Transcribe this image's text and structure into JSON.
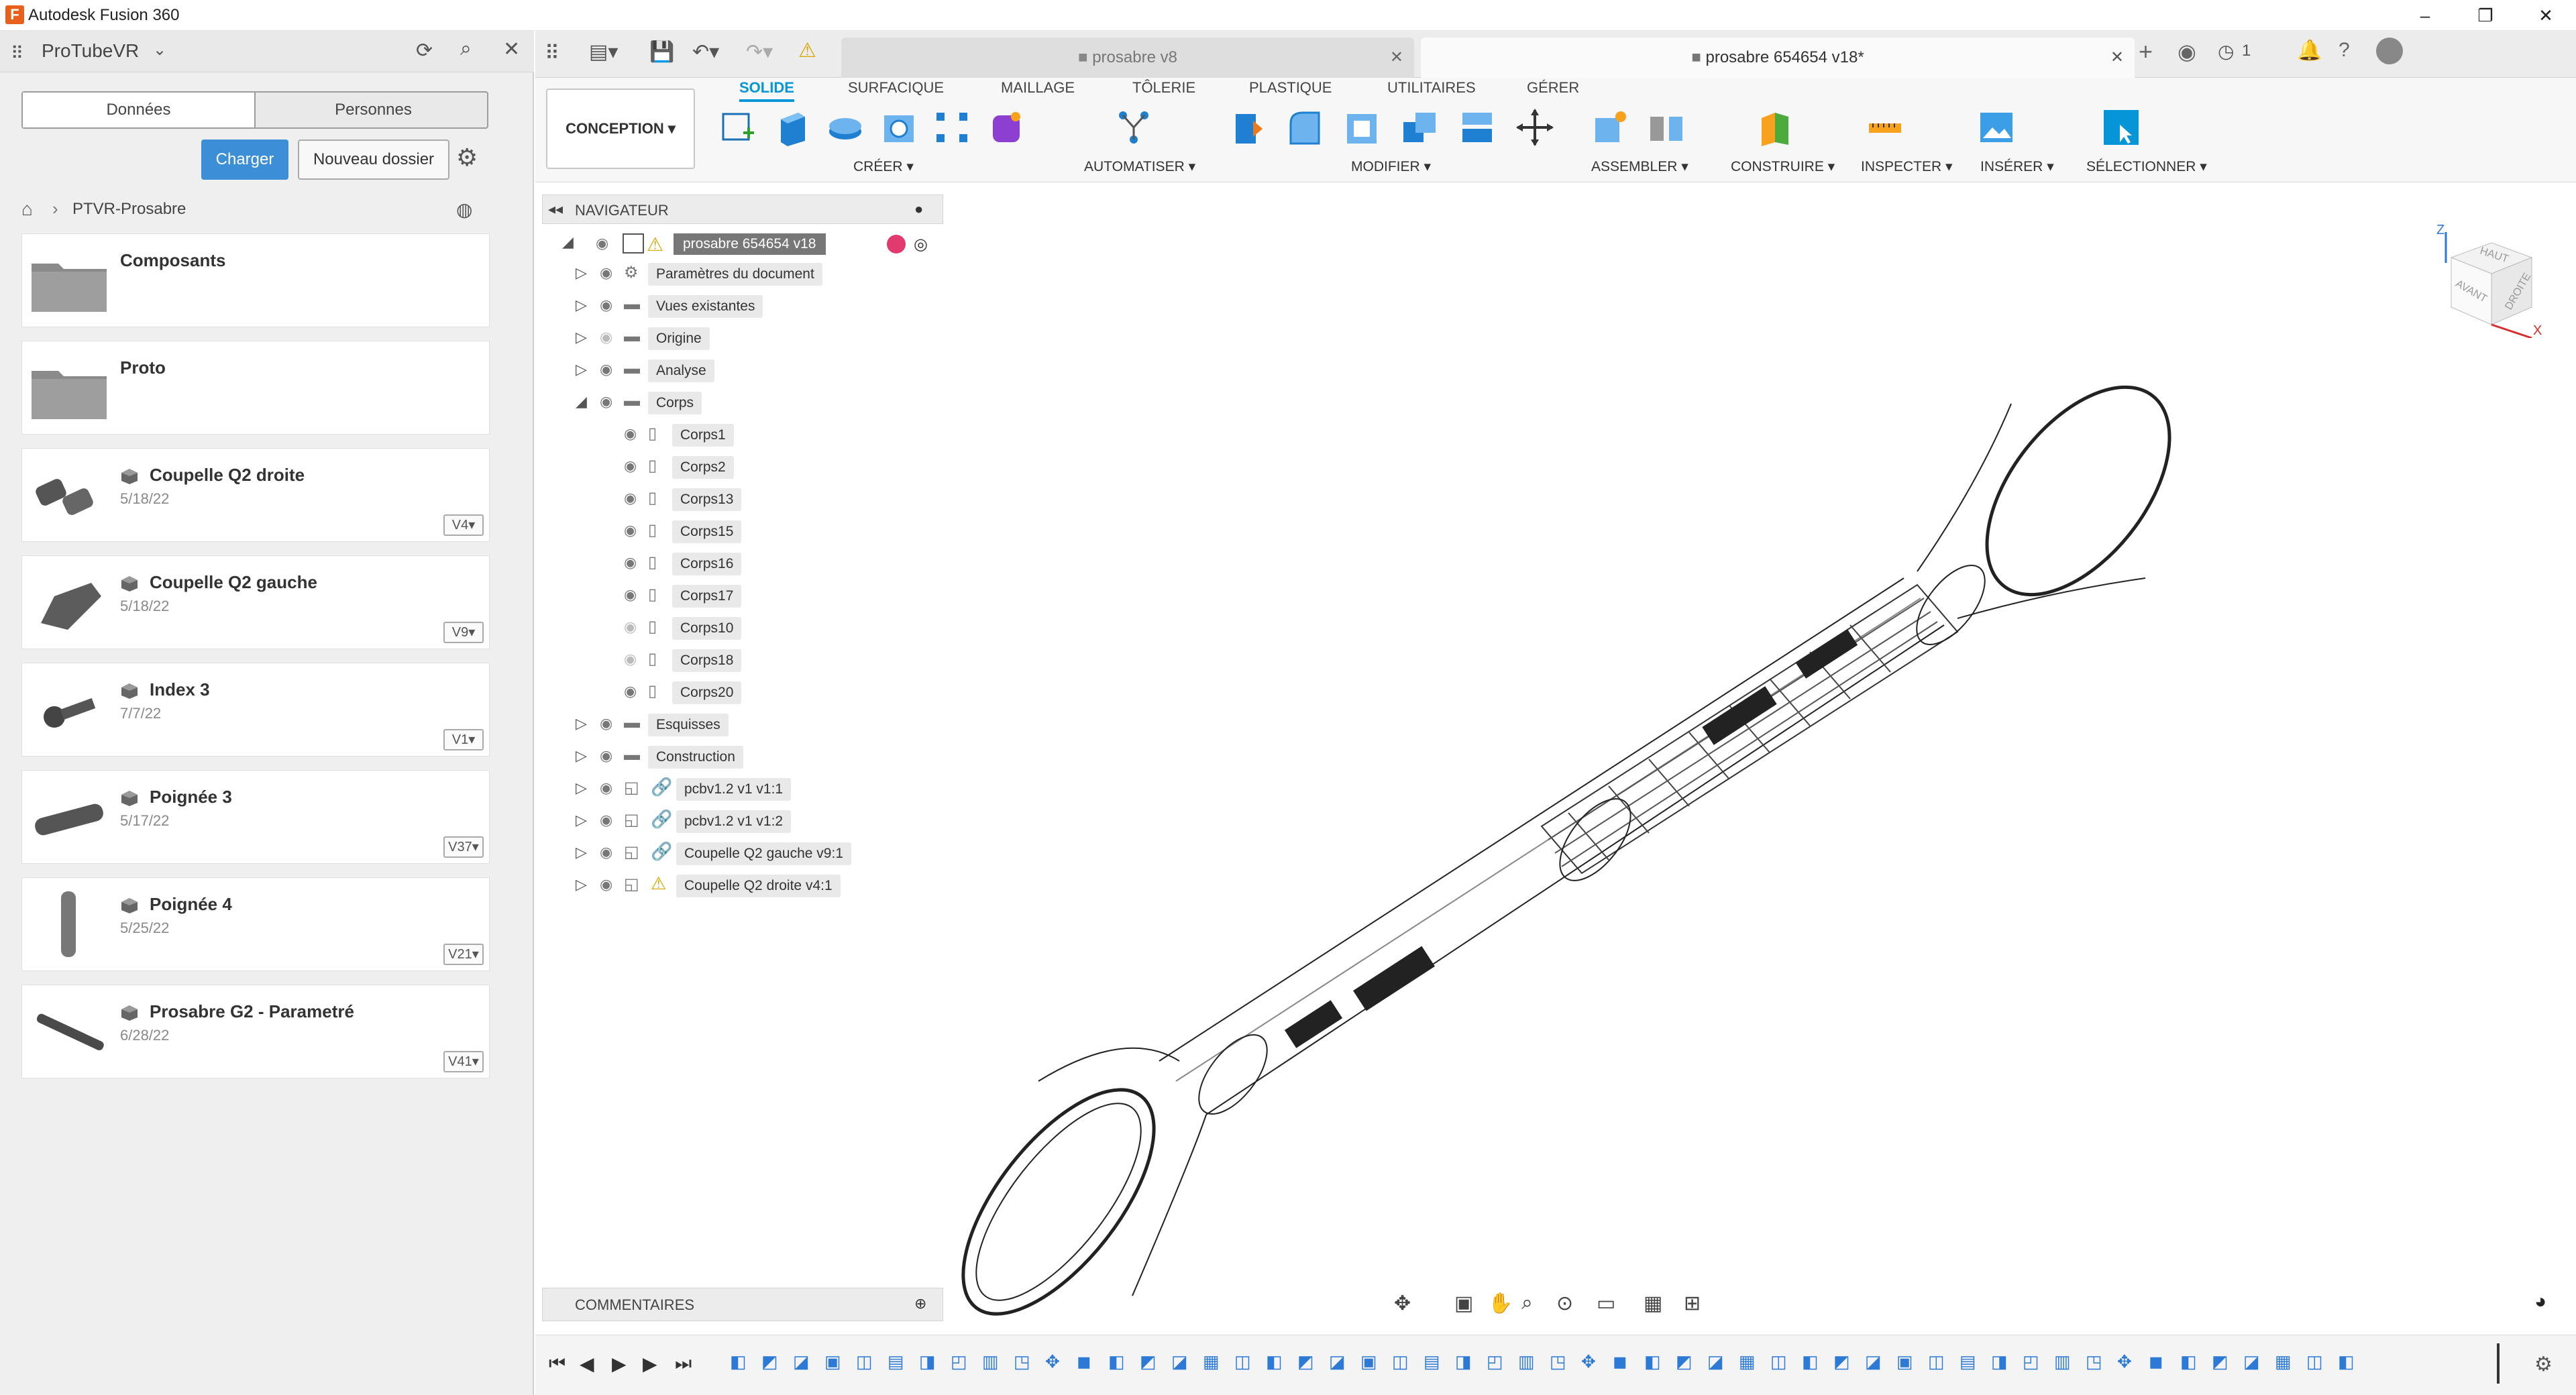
{
  "app": {
    "title": "Autodesk Fusion 360"
  },
  "data_panel": {
    "project": "ProTubeVR",
    "tabs": [
      "Données",
      "Personnes"
    ],
    "upload_label": "Charger",
    "new_folder_label": "Nouveau dossier",
    "breadcrumb": "PTVR-Prosabre",
    "folders": [
      "Composants",
      "Proto"
    ],
    "items": [
      {
        "name": "Coupelle Q2 droite",
        "date": "5/18/22",
        "version": "V4"
      },
      {
        "name": "Coupelle Q2 gauche",
        "date": "5/18/22",
        "version": "V9"
      },
      {
        "name": "Index 3",
        "date": "7/7/22",
        "version": "V1"
      },
      {
        "name": "Poignée 3",
        "date": "5/17/22",
        "version": "V37"
      },
      {
        "name": "Poignée 4",
        "date": "5/25/22",
        "version": "V21"
      },
      {
        "name": "Prosabre G2 - Parametré",
        "date": "6/28/22",
        "version": "V41"
      }
    ]
  },
  "doc_tabs": [
    {
      "title": "prosabre v8",
      "active": false
    },
    {
      "title": "prosabre 654654 v18*",
      "active": true
    }
  ],
  "notifications_count": "1",
  "workspace": "CONCEPTION",
  "ribbon": {
    "tabs": [
      "SOLIDE",
      "SURFACIQUE",
      "MAILLAGE",
      "TÔLERIE",
      "PLASTIQUE",
      "UTILITAIRES",
      "GÉRER"
    ],
    "groups": [
      "CRÉER",
      "AUTOMATISER",
      "MODIFIER",
      "ASSEMBLER",
      "CONSTRUIRE",
      "INSPECTER",
      "INSÉRER",
      "SÉLECTIONNER"
    ]
  },
  "browser": {
    "title": "NAVIGATEUR",
    "root": "prosabre 654654 v18",
    "nodes": [
      "Paramètres du document",
      "Vues existantes",
      "Origine",
      "Analyse",
      "Corps"
    ],
    "bodies": [
      "Corps1",
      "Corps2",
      "Corps13",
      "Corps15",
      "Corps16",
      "Corps17",
      "Corps10",
      "Corps18",
      "Corps20"
    ],
    "bottom_nodes": [
      "Esquisses",
      "Construction"
    ],
    "components": [
      "pcbv1.2 v1 v1:1",
      "pcbv1.2 v1 v1:2",
      "Coupelle Q2 gauche v9:1",
      "Coupelle Q2 droite v4:1"
    ]
  },
  "comments": {
    "title": "COMMENTAIRES"
  },
  "viewcube": {
    "top": "HAUT",
    "front": "AVANT",
    "right": "DROITE",
    "z": "Z",
    "x": "X"
  },
  "colors": {
    "accent": "#0696d7",
    "upload": "#3c8ed6",
    "warning": "#f5c400",
    "logo": "#e8611c"
  }
}
